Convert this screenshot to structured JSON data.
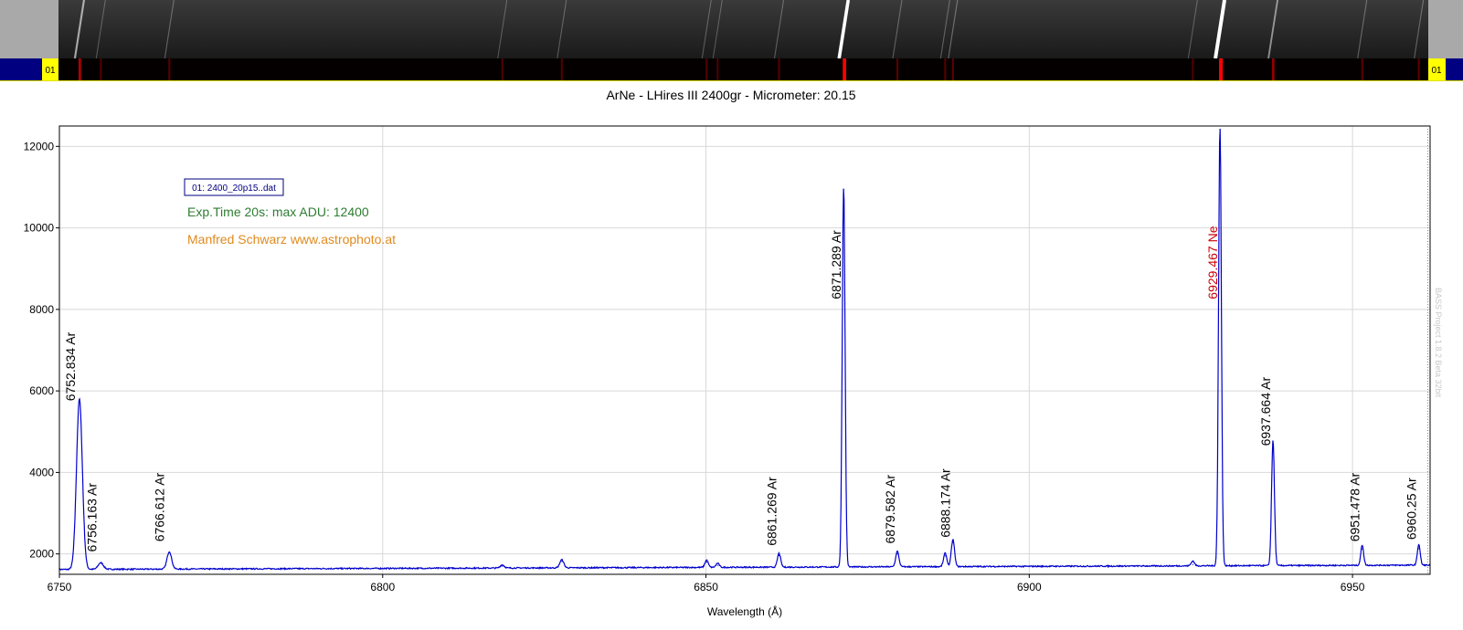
{
  "strip": {
    "left_tag": "01",
    "right_tag": "01",
    "tag_color": "#ffff00",
    "bar_color": "#000080"
  },
  "chart_data": {
    "type": "line",
    "title": "ArNe - LHires III 2400gr - Micrometer: 20.15",
    "xlabel": "Wavelength (Å)",
    "ylabel": "",
    "xlim": [
      6750,
      6962
    ],
    "ylim": [
      1500,
      12500
    ],
    "x_ticks": [
      6750,
      6800,
      6850,
      6900,
      6950
    ],
    "y_ticks": [
      2000,
      4000,
      6000,
      8000,
      10000,
      12000
    ],
    "grid": true,
    "legend": {
      "entry": "01: 2400_20p15..dat",
      "placement": "top-left"
    },
    "annotations": [
      {
        "text": "Exp.Time 20s: max ADU: 12400",
        "color": "#2e7d32"
      },
      {
        "text": "Manfred Schwarz www.astrophoto.at",
        "color": "#e08a1e"
      }
    ],
    "watermark": "BASS Project 1.8.2 Beta 32bit",
    "baseline": 1620,
    "series": [
      {
        "name": "01: 2400_20p15..dat",
        "color": "#0000cc",
        "peaks": [
          {
            "x": 6753.1,
            "y": 5800,
            "w": 0.45
          },
          {
            "x": 6756.4,
            "y": 1780,
            "w": 0.4
          },
          {
            "x": 6767.0,
            "y": 2050,
            "w": 0.35
          },
          {
            "x": 6818.5,
            "y": 1700,
            "w": 0.3
          },
          {
            "x": 6827.7,
            "y": 1820,
            "w": 0.3
          },
          {
            "x": 6850.1,
            "y": 1800,
            "w": 0.25
          },
          {
            "x": 6851.8,
            "y": 1720,
            "w": 0.25
          },
          {
            "x": 6861.3,
            "y": 1960,
            "w": 0.25
          },
          {
            "x": 6871.3,
            "y": 10950,
            "w": 0.22
          },
          {
            "x": 6879.6,
            "y": 2000,
            "w": 0.25
          },
          {
            "x": 6887.0,
            "y": 1950,
            "w": 0.25
          },
          {
            "x": 6888.2,
            "y": 2280,
            "w": 0.25
          },
          {
            "x": 6925.3,
            "y": 1740,
            "w": 0.25
          },
          {
            "x": 6929.5,
            "y": 12400,
            "w": 0.22
          },
          {
            "x": 6937.7,
            "y": 4700,
            "w": 0.22
          },
          {
            "x": 6951.5,
            "y": 2120,
            "w": 0.22
          },
          {
            "x": 6960.25,
            "y": 2130,
            "w": 0.22
          }
        ]
      }
    ],
    "line_labels": [
      {
        "text": "6752.834 Ar",
        "x": 6752.834,
        "y": 5750,
        "color": "#000000"
      },
      {
        "text": "6756.163 Ar",
        "x": 6756.163,
        "y": 2050,
        "color": "#000000"
      },
      {
        "text": "6766.612 Ar",
        "x": 6766.612,
        "y": 2300,
        "color": "#000000"
      },
      {
        "text": "6861.269 Ar",
        "x": 6861.269,
        "y": 2200,
        "color": "#000000"
      },
      {
        "text": "6871.289 Ar",
        "x": 6871.289,
        "y": 8250,
        "color": "#000000"
      },
      {
        "text": "6879.582 Ar",
        "x": 6879.582,
        "y": 2250,
        "color": "#000000"
      },
      {
        "text": "6888.174 Ar",
        "x": 6888.174,
        "y": 2400,
        "color": "#000000"
      },
      {
        "text": "6929.467 Ne",
        "x": 6929.467,
        "y": 8250,
        "color": "#cc0000"
      },
      {
        "text": "6937.664 Ar",
        "x": 6937.664,
        "y": 4650,
        "color": "#000000"
      },
      {
        "text": "6951.478 Ar",
        "x": 6951.478,
        "y": 2300,
        "color": "#000000"
      },
      {
        "text": "6960.25 Ar",
        "x": 6960.25,
        "y": 2350,
        "color": "#000000"
      }
    ]
  }
}
